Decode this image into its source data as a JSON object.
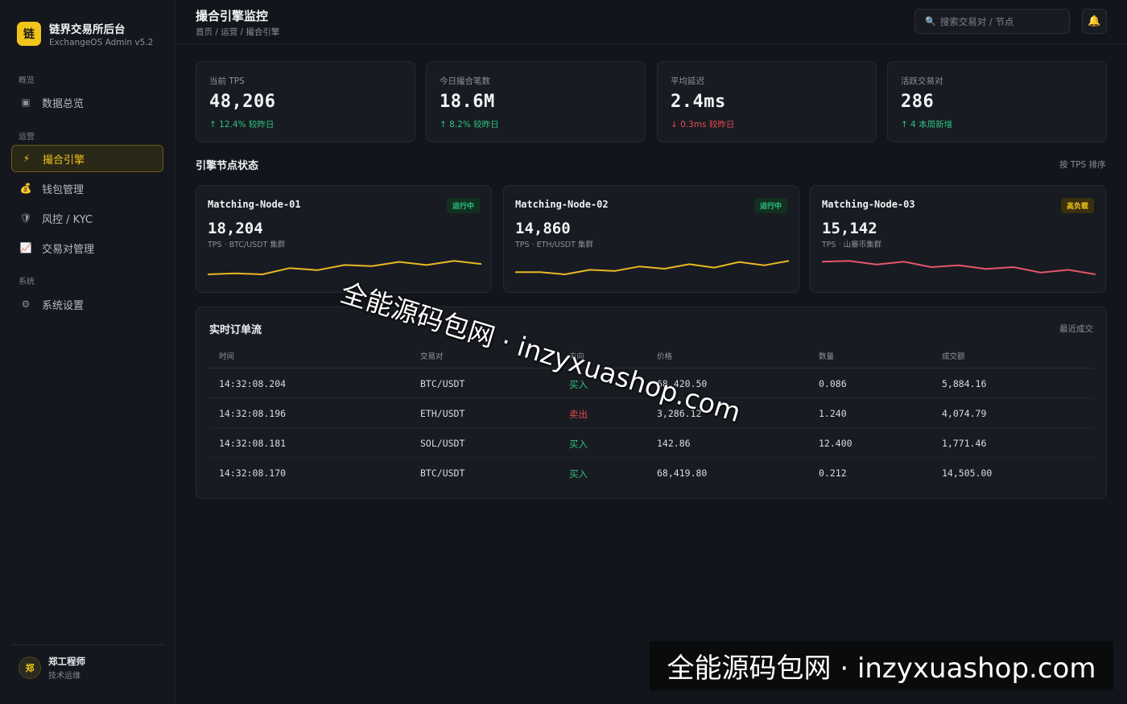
{
  "brand": {
    "logo": "链",
    "title": "链界交易所后台",
    "subtitle": "ExchangeOS Admin v5.2"
  },
  "sidebar": {
    "sections": [
      "概览",
      "运营",
      "系统"
    ],
    "items": [
      {
        "label": "数据总览",
        "icon": "dashboard-icon",
        "glyph": "▣"
      },
      {
        "label": "撮合引擎",
        "icon": "bolt-icon",
        "glyph": "⚡",
        "active": true
      },
      {
        "label": "钱包管理",
        "icon": "moneybag-icon",
        "glyph": "💰"
      },
      {
        "label": "风控 / KYC",
        "icon": "shield-icon",
        "glyph": "🛡"
      },
      {
        "label": "交易对管理",
        "icon": "chart-icon",
        "glyph": "📈"
      },
      {
        "label": "系统设置",
        "icon": "gear-icon",
        "glyph": "⚙"
      }
    ]
  },
  "user": {
    "avatar": "郑",
    "name": "郑工程师",
    "role": "技术运维"
  },
  "header": {
    "title": "撮合引擎监控",
    "breadcrumb": "首页 / 运营 / 撮合引擎",
    "search_placeholder": "搜索交易对 / 节点",
    "search_icon": "🔍",
    "bell_icon": "🔔"
  },
  "stats": [
    {
      "label": "当前 TPS",
      "value": "48,206",
      "delta": "↑ 12.4% 较昨日",
      "trend": "up"
    },
    {
      "label": "今日撮合笔数",
      "value": "18.6M",
      "delta": "↑ 8.2% 较昨日",
      "trend": "up"
    },
    {
      "label": "平均延迟",
      "value": "2.4ms",
      "delta": "↓ 0.3ms 较昨日",
      "trend": "down"
    },
    {
      "label": "活跃交易对",
      "value": "286",
      "delta": "↑ 4 本周新增",
      "trend": "up"
    }
  ],
  "nodes_section": {
    "title": "引擎节点状态",
    "sort_label": "按 TPS 排序"
  },
  "nodes": [
    {
      "name": "Matching-Node-01",
      "status": "运行中",
      "status_type": "ok",
      "tps": "18,204",
      "sub": "TPS · BTC/USDT 集群",
      "color": "#e8b923",
      "spark": [
        3,
        4,
        3,
        9,
        7,
        12,
        11,
        15,
        12,
        16,
        13
      ]
    },
    {
      "name": "Matching-Node-02",
      "status": "运行中",
      "status_type": "ok",
      "tps": "14,860",
      "sub": "TPS · ETH/USDT 集群",
      "color": "#e8b923",
      "spark": [
        4,
        4,
        2,
        6,
        5,
        9,
        7,
        11,
        8,
        13,
        10,
        14
      ]
    },
    {
      "name": "Matching-Node-03",
      "status": "高负载",
      "status_type": "warn",
      "tps": "15,142",
      "sub": "TPS · 山寨币集群",
      "color": "#e5566b",
      "spark": [
        14,
        15,
        11,
        14,
        8,
        10,
        6,
        8,
        2,
        5,
        0
      ]
    }
  ],
  "orders": {
    "title": "实时订单流",
    "aside": "最近成交",
    "columns": [
      "时间",
      "交易对",
      "方向",
      "价格",
      "数量",
      "成交额"
    ],
    "rows": [
      {
        "time": "14:32:08.204",
        "pair": "BTC/USDT",
        "side": "买入",
        "side_type": "buy",
        "price": "68,420.50",
        "qty": "0.086",
        "amount": "5,884.16"
      },
      {
        "time": "14:32:08.196",
        "pair": "ETH/USDT",
        "side": "卖出",
        "side_type": "sell",
        "price": "3,286.12",
        "qty": "1.240",
        "amount": "4,074.79"
      },
      {
        "time": "14:32:08.181",
        "pair": "SOL/USDT",
        "side": "买入",
        "side_type": "buy",
        "price": "142.86",
        "qty": "12.400",
        "amount": "1,771.46"
      },
      {
        "time": "14:32:08.170",
        "pair": "BTC/USDT",
        "side": "买入",
        "side_type": "buy",
        "price": "68,419.80",
        "qty": "0.212",
        "amount": "14,505.00"
      }
    ]
  },
  "watermark": {
    "text": "全能源码包网 · inzyxuashop.com"
  },
  "colors": {
    "accent": "#f0c419",
    "up": "#2ec27e",
    "down": "#e5484d",
    "background": "#12151b",
    "card": "#181b22"
  }
}
